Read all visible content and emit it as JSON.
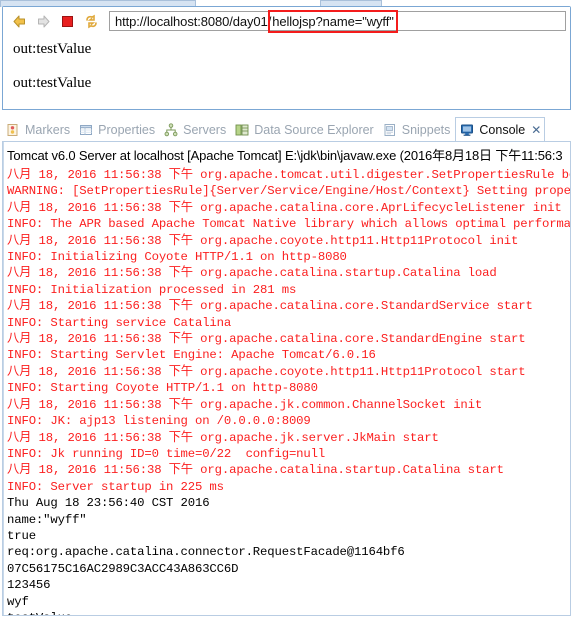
{
  "browser": {
    "toolbar": {
      "back_icon": "back-arrow-icon",
      "forward_icon": "forward-arrow-icon",
      "stop_icon": "stop-square-icon",
      "refresh_icon": "refresh-icon"
    },
    "url": {
      "prefix": "http://localhost:8080/day01/",
      "highlighted": "hellojsp?name=\"wyff\"",
      "full": "http://localhost:8080/day01/hellojsp?name=\"wyff\"",
      "highlight_color": "#f41c1c"
    },
    "page_lines": [
      "out:testValue",
      "out:testValue"
    ]
  },
  "view_tabs": [
    {
      "label": "Markers",
      "icon": "markers-icon",
      "active": false
    },
    {
      "label": "Properties",
      "icon": "properties-icon",
      "active": false
    },
    {
      "label": "Servers",
      "icon": "servers-icon",
      "active": false
    },
    {
      "label": "Data Source Explorer",
      "icon": "data-source-explorer-icon",
      "active": false
    },
    {
      "label": "Snippets",
      "icon": "snippets-icon",
      "active": false
    },
    {
      "label": "Console",
      "icon": "console-icon",
      "active": true,
      "close_label": "✕"
    }
  ],
  "console": {
    "header": "Tomcat v6.0 Server at localhost [Apache Tomcat] E:\\jdk\\bin\\javaw.exe (2016年8月18日 下午11:56:3",
    "error_color": "#fb2020",
    "output_color": "#000000",
    "lines": [
      {
        "text": "八月 18, 2016 11:56:38 下午 org.apache.tomcat.util.digester.SetPropertiesRule begin",
        "stream": "err"
      },
      {
        "text": "WARNING: [SetPropertiesRule]{Server/Service/Engine/Host/Context} Setting property",
        "stream": "err"
      },
      {
        "text": "八月 18, 2016 11:56:38 下午 org.apache.catalina.core.AprLifecycleListener init",
        "stream": "err"
      },
      {
        "text": "INFO: The APR based Apache Tomcat Native library which allows optimal performance",
        "stream": "err"
      },
      {
        "text": "八月 18, 2016 11:56:38 下午 org.apache.coyote.http11.Http11Protocol init",
        "stream": "err"
      },
      {
        "text": "INFO: Initializing Coyote HTTP/1.1 on http-8080",
        "stream": "err"
      },
      {
        "text": "八月 18, 2016 11:56:38 下午 org.apache.catalina.startup.Catalina load",
        "stream": "err"
      },
      {
        "text": "INFO: Initialization processed in 281 ms",
        "stream": "err"
      },
      {
        "text": "八月 18, 2016 11:56:38 下午 org.apache.catalina.core.StandardService start",
        "stream": "err"
      },
      {
        "text": "INFO: Starting service Catalina",
        "stream": "err"
      },
      {
        "text": "八月 18, 2016 11:56:38 下午 org.apache.catalina.core.StandardEngine start",
        "stream": "err"
      },
      {
        "text": "INFO: Starting Servlet Engine: Apache Tomcat/6.0.16",
        "stream": "err"
      },
      {
        "text": "八月 18, 2016 11:56:38 下午 org.apache.coyote.http11.Http11Protocol start",
        "stream": "err"
      },
      {
        "text": "INFO: Starting Coyote HTTP/1.1 on http-8080",
        "stream": "err"
      },
      {
        "text": "八月 18, 2016 11:56:38 下午 org.apache.jk.common.ChannelSocket init",
        "stream": "err"
      },
      {
        "text": "INFO: JK: ajp13 listening on /0.0.0.0:8009",
        "stream": "err"
      },
      {
        "text": "八月 18, 2016 11:56:38 下午 org.apache.jk.server.JkMain start",
        "stream": "err"
      },
      {
        "text": "INFO: Jk running ID=0 time=0/22  config=null",
        "stream": "err"
      },
      {
        "text": "八月 18, 2016 11:56:38 下午 org.apache.catalina.startup.Catalina start",
        "stream": "err"
      },
      {
        "text": "INFO: Server startup in 225 ms",
        "stream": "err"
      },
      {
        "text": "Thu Aug 18 23:56:40 CST 2016",
        "stream": "out"
      },
      {
        "text": "name:\"wyff\"",
        "stream": "out"
      },
      {
        "text": "true",
        "stream": "out"
      },
      {
        "text": "req:org.apache.catalina.connector.RequestFacade@1164bf6",
        "stream": "out"
      },
      {
        "text": "07C56175C16AC2989C3ACC43A863CC6D",
        "stream": "out"
      },
      {
        "text": "123456",
        "stream": "out"
      },
      {
        "text": "wyf",
        "stream": "out"
      },
      {
        "text": "testValue",
        "stream": "out"
      }
    ]
  }
}
